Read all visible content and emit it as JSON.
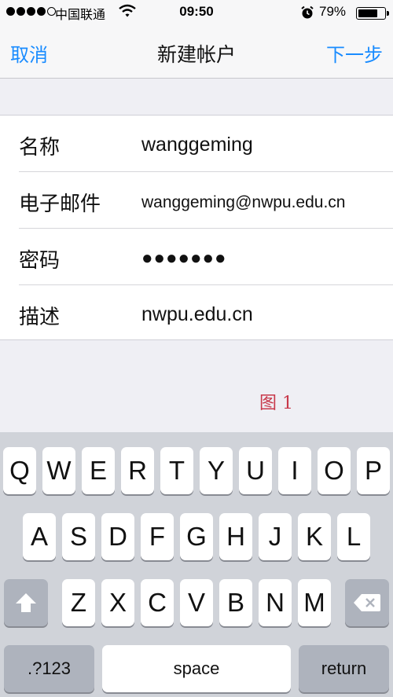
{
  "status_bar": {
    "carrier": "中国联通",
    "time": "09:50",
    "battery_percent": "79%",
    "battery_level": 0.79,
    "signal_bars": 4,
    "icons": [
      "signal-dots-icon",
      "wifi-icon",
      "alarm-icon",
      "battery-icon"
    ]
  },
  "nav": {
    "cancel": "取消",
    "title": "新建帐户",
    "next": "下一步",
    "accent_color": "#1a8cff"
  },
  "form": {
    "rows": [
      {
        "label": "名称",
        "value": "wanggeming"
      },
      {
        "label": "电子邮件",
        "value": "wanggeming@nwpu.edu.cn"
      },
      {
        "label": "密码",
        "value": "●●●●●●●"
      },
      {
        "label": "描述",
        "value": "nwpu.edu.cn"
      }
    ]
  },
  "caption": "图 1",
  "keyboard": {
    "row1": [
      "Q",
      "W",
      "E",
      "R",
      "T",
      "Y",
      "U",
      "I",
      "O",
      "P"
    ],
    "row2": [
      "A",
      "S",
      "D",
      "F",
      "G",
      "H",
      "J",
      "K",
      "L"
    ],
    "row3": [
      "Z",
      "X",
      "C",
      "V",
      "B",
      "N",
      "M"
    ],
    "numbers": ".?123",
    "space": "space",
    "return": "return"
  }
}
